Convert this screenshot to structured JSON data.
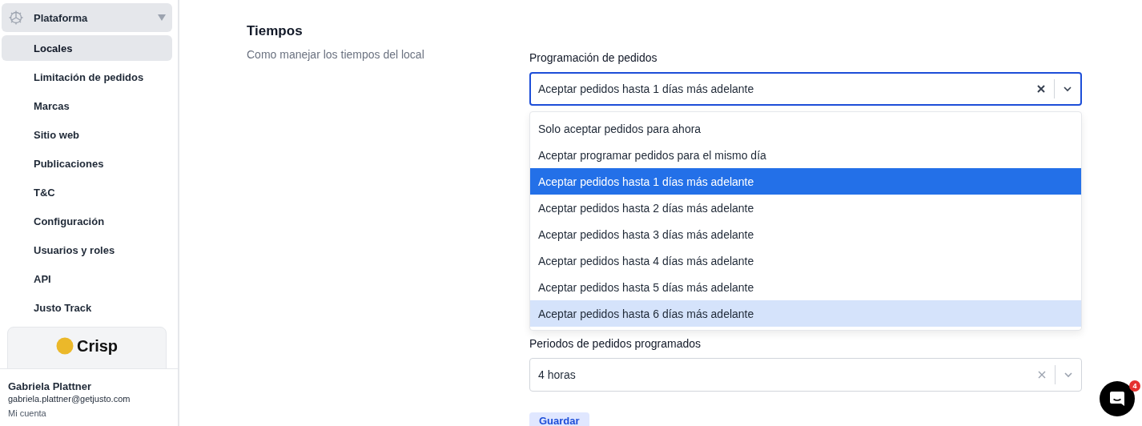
{
  "sidebar": {
    "section": {
      "label": "Plataforma",
      "expanded": true
    },
    "items": [
      {
        "label": "Locales",
        "selected": true
      },
      {
        "label": "Limitación de pedidos",
        "selected": false
      },
      {
        "label": "Marcas",
        "selected": false
      },
      {
        "label": "Sitio web",
        "selected": false
      },
      {
        "label": "Publicaciones",
        "selected": false
      },
      {
        "label": "T&C",
        "selected": false
      },
      {
        "label": "Configuración",
        "selected": false
      },
      {
        "label": "Usuarios y roles",
        "selected": false
      },
      {
        "label": "API",
        "selected": false
      },
      {
        "label": "Justo Track",
        "selected": false
      }
    ],
    "promo": {
      "title": "Crisp"
    },
    "user": {
      "name": "Gabriela Plattner",
      "email": "gabriela.plattner@getjusto.com",
      "link": "Mi cuenta"
    }
  },
  "section": {
    "title": "Tiempos",
    "description": "Como manejar los tiempos del local"
  },
  "fields": [
    {
      "label": "Programación de pedidos",
      "value": "Aceptar pedidos hasta 1 días más adelante",
      "focused": true,
      "open": true,
      "options": [
        {
          "label": "Solo aceptar pedidos para ahora",
          "selected": false,
          "hovered": false
        },
        {
          "label": "Aceptar programar pedidos para el mismo día",
          "selected": false,
          "hovered": false
        },
        {
          "label": "Aceptar pedidos hasta 1 días más adelante",
          "selected": true,
          "hovered": false
        },
        {
          "label": "Aceptar pedidos hasta 2 días más adelante",
          "selected": false,
          "hovered": false
        },
        {
          "label": "Aceptar pedidos hasta 3 días más adelante",
          "selected": false,
          "hovered": false
        },
        {
          "label": "Aceptar pedidos hasta 4 días más adelante",
          "selected": false,
          "hovered": false
        },
        {
          "label": "Aceptar pedidos hasta 5 días más adelante",
          "selected": false,
          "hovered": false
        },
        {
          "label": "Aceptar pedidos hasta 6 días más adelante",
          "selected": false,
          "hovered": true
        }
      ]
    },
    {
      "label": "Periodos de pedidos programados",
      "value": "4 horas",
      "focused": false
    }
  ],
  "save_button": {
    "label": "Guardar"
  },
  "chat": {
    "badge": "4"
  }
}
